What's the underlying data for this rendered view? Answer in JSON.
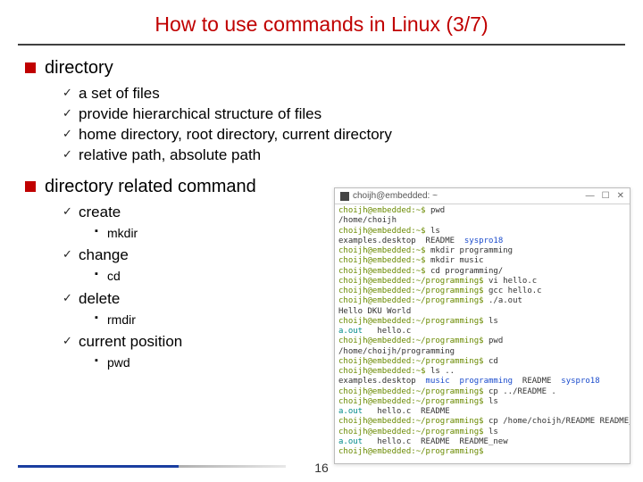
{
  "title": "How to use commands in Linux (3/7)",
  "page_number": "16",
  "sections": [
    {
      "heading": "directory",
      "items": [
        {
          "text": "a set of files"
        },
        {
          "text": "provide hierarchical structure of files"
        },
        {
          "text": "home directory, root directory, current directory"
        },
        {
          "text": "relative path, absolute path"
        }
      ]
    },
    {
      "heading": "directory related command",
      "items": [
        {
          "text": "create",
          "sub": [
            "mkdir"
          ]
        },
        {
          "text": "change",
          "sub": [
            "cd"
          ]
        },
        {
          "text": "delete",
          "sub": [
            "rmdir"
          ]
        },
        {
          "text": "current position",
          "sub": [
            "pwd"
          ]
        }
      ]
    }
  ],
  "terminal": {
    "title": "choijh@embedded: ~",
    "lines": [
      {
        "seg": [
          {
            "t": "choijh@embedded:~$ ",
            "c": "g"
          },
          {
            "t": "pwd"
          }
        ]
      },
      {
        "seg": [
          {
            "t": "/home/choijh"
          }
        ]
      },
      {
        "seg": [
          {
            "t": "choijh@embedded:~$ ",
            "c": "g"
          },
          {
            "t": "ls"
          }
        ]
      },
      {
        "seg": [
          {
            "t": "examples.desktop  README  ",
            "c": ""
          },
          {
            "t": "syspro18",
            "c": "b"
          }
        ]
      },
      {
        "seg": [
          {
            "t": "choijh@embedded:~$ ",
            "c": "g"
          },
          {
            "t": "mkdir programming"
          }
        ]
      },
      {
        "seg": [
          {
            "t": "choijh@embedded:~$ ",
            "c": "g"
          },
          {
            "t": "mkdir music"
          }
        ]
      },
      {
        "seg": [
          {
            "t": "choijh@embedded:~$ ",
            "c": "g"
          },
          {
            "t": "cd programming/"
          }
        ]
      },
      {
        "seg": [
          {
            "t": "choijh@embedded:~/programming$ ",
            "c": "g"
          },
          {
            "t": "vi hello.c"
          }
        ]
      },
      {
        "seg": [
          {
            "t": "choijh@embedded:~/programming$ ",
            "c": "g"
          },
          {
            "t": "gcc hello.c"
          }
        ]
      },
      {
        "seg": [
          {
            "t": "choijh@embedded:~/programming$ ",
            "c": "g"
          },
          {
            "t": "./a.out"
          }
        ]
      },
      {
        "seg": [
          {
            "t": "Hello DKU World"
          }
        ]
      },
      {
        "seg": [
          {
            "t": "choijh@embedded:~/programming$ ",
            "c": "g"
          },
          {
            "t": "ls"
          }
        ]
      },
      {
        "seg": [
          {
            "t": "a.out",
            "c": "c"
          },
          {
            "t": "   hello.c"
          }
        ]
      },
      {
        "seg": [
          {
            "t": "choijh@embedded:~/programming$ ",
            "c": "g"
          },
          {
            "t": "pwd"
          }
        ]
      },
      {
        "seg": [
          {
            "t": "/home/choijh/programming"
          }
        ]
      },
      {
        "seg": [
          {
            "t": "choijh@embedded:~/programming$ ",
            "c": "g"
          },
          {
            "t": "cd"
          }
        ]
      },
      {
        "seg": [
          {
            "t": "choijh@embedded:~$ ",
            "c": "g"
          },
          {
            "t": "ls .."
          }
        ]
      },
      {
        "seg": [
          {
            "t": "examples.desktop  "
          },
          {
            "t": "music  programming",
            "c": "b"
          },
          {
            "t": "  README  "
          },
          {
            "t": "syspro18",
            "c": "b"
          }
        ]
      },
      {
        "seg": [
          {
            "t": "choijh@embedded:~/programming$ ",
            "c": "g"
          },
          {
            "t": "cp ../README ."
          }
        ]
      },
      {
        "seg": [
          {
            "t": "choijh@embedded:~/programming$ ",
            "c": "g"
          },
          {
            "t": "ls"
          }
        ]
      },
      {
        "seg": [
          {
            "t": "a.out",
            "c": "c"
          },
          {
            "t": "   hello.c  README"
          }
        ]
      },
      {
        "seg": [
          {
            "t": "choijh@embedded:~/programming$ ",
            "c": "g"
          },
          {
            "t": "cp /home/choijh/README README_new"
          }
        ]
      },
      {
        "seg": [
          {
            "t": "choijh@embedded:~/programming$ ",
            "c": "g"
          },
          {
            "t": "ls"
          }
        ]
      },
      {
        "seg": [
          {
            "t": "a.out",
            "c": "c"
          },
          {
            "t": "   hello.c  README  README_new"
          }
        ]
      },
      {
        "seg": [
          {
            "t": "choijh@embedded:~/programming$ ",
            "c": "g"
          }
        ]
      }
    ]
  }
}
